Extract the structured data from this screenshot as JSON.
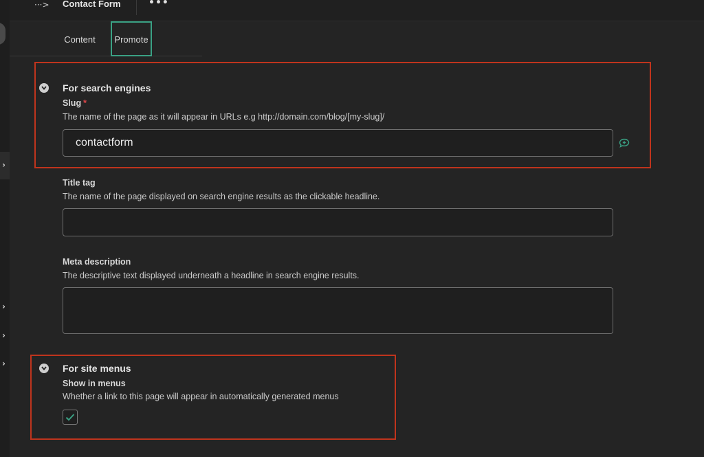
{
  "header": {
    "breadcrumb_icon": "···>",
    "title": "Contact Form",
    "more_label": "•••"
  },
  "tabs": [
    {
      "label": "Content",
      "active": false
    },
    {
      "label": "Promote",
      "active": true
    }
  ],
  "sections": {
    "search": {
      "title": "For search engines",
      "slug": {
        "label": "Slug",
        "required_mark": "*",
        "help": "The name of the page as it will appear in URLs e.g http://domain.com/blog/[my-slug]/",
        "value": "contactform"
      },
      "title_tag": {
        "label": "Title tag",
        "help": "The name of the page displayed on search engine results as the clickable headline.",
        "value": ""
      },
      "meta_description": {
        "label": "Meta description",
        "help": "The descriptive text displayed underneath a headline in search engine results.",
        "value": ""
      }
    },
    "menus": {
      "title": "For site menus",
      "show_in_menus": {
        "label": "Show in menus",
        "help": "Whether a link to this page will appear in automatically generated menus",
        "checked": true
      }
    }
  },
  "colors": {
    "background": "#242424",
    "accent": "#3aa184",
    "annotation": "#c0341d",
    "required": "#e0474a"
  },
  "icons": {
    "breadcrumb": "breadcrumb-icon",
    "section_toggle": "chevron-down-icon",
    "comment": "comment-add-icon",
    "check": "check-icon",
    "gutter": "chevron-right-icon"
  }
}
